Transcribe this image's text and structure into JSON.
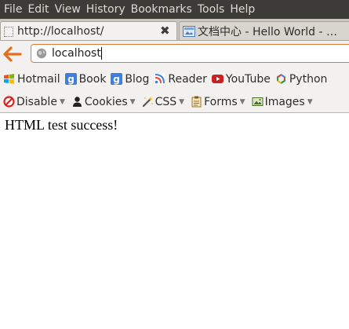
{
  "menubar": {
    "items": [
      "File",
      "Edit",
      "View",
      "History",
      "Bookmarks",
      "Tools",
      "Help"
    ]
  },
  "tabs": {
    "active": {
      "title": "http://localhost/",
      "close": "✖"
    },
    "inactive": {
      "title": "文档中心 - Hello World - …"
    }
  },
  "navbar": {
    "url": "localhost"
  },
  "bookmarks": {
    "items": [
      {
        "label": "Hotmail",
        "icon": "windows-icon"
      },
      {
        "label": "Book",
        "icon": "google-icon"
      },
      {
        "label": "Blog",
        "icon": "google-icon"
      },
      {
        "label": "Reader",
        "icon": "reader-icon"
      },
      {
        "label": "YouTube",
        "icon": "youtube-icon"
      },
      {
        "label": "Python",
        "icon": "chrome-logo-icon"
      }
    ]
  },
  "devbar": {
    "items": [
      {
        "label": "Disable",
        "icon": "disable-icon"
      },
      {
        "label": "Cookies",
        "icon": "cookie-person-icon"
      },
      {
        "label": "CSS",
        "icon": "css-wand-icon"
      },
      {
        "label": "Forms",
        "icon": "forms-icon"
      },
      {
        "label": "Images",
        "icon": "images-icon"
      }
    ]
  },
  "content": {
    "text": "HTML test success!"
  },
  "colors": {
    "menubar_bg": "#3c3b37",
    "url_border": "#e07a36",
    "back_arrow": "#e36f1e"
  }
}
